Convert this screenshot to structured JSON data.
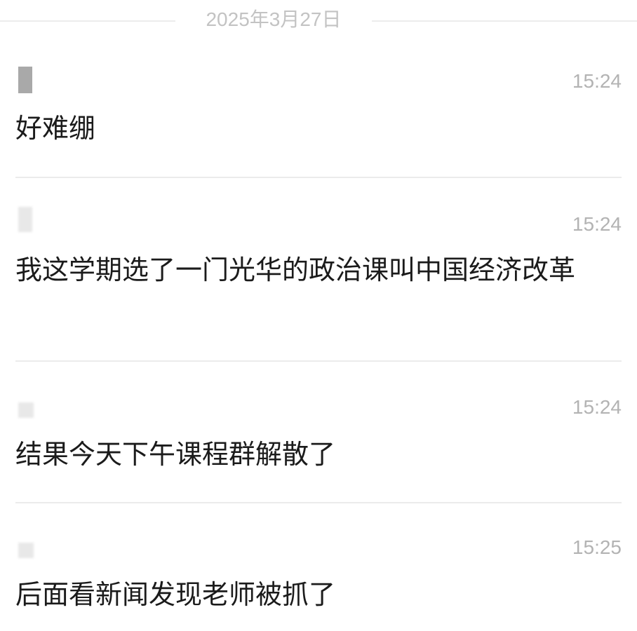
{
  "date_separator": "2025年3月27日",
  "messages": [
    {
      "time": "15:24",
      "text": "好难绷"
    },
    {
      "time": "15:24",
      "text": "我这学期选了一门光华的政治课叫中国经济改革"
    },
    {
      "time": "15:24",
      "text": "结果今天下午课程群解散了"
    },
    {
      "time": "15:25",
      "text": "后面看新闻发现老师被抓了"
    }
  ]
}
